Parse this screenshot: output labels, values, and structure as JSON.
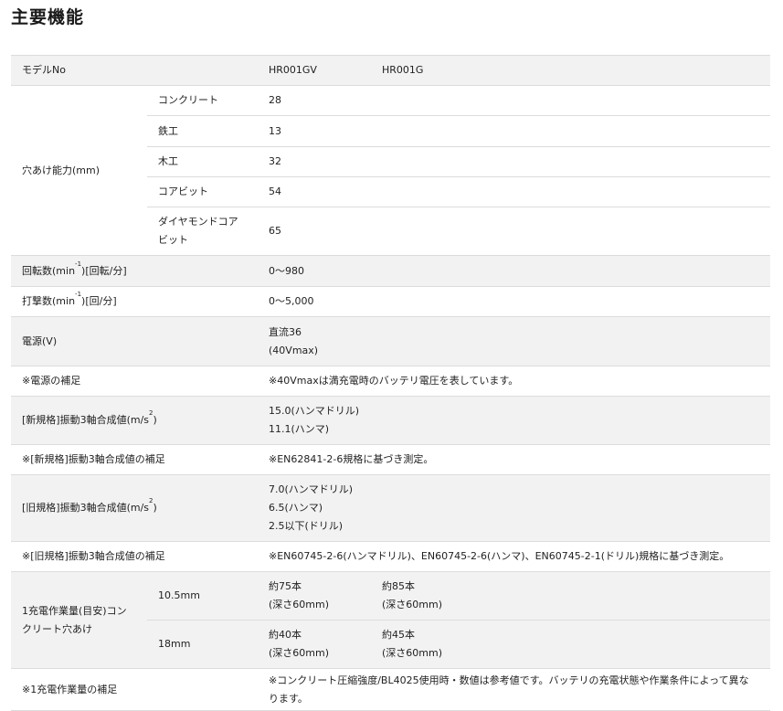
{
  "title": "主要機能",
  "header": {
    "label": "モデルNo",
    "col1": "HR001GV",
    "col2": "HR001G"
  },
  "drilling": {
    "label": "穴あけ能力(mm)",
    "items": [
      {
        "label": "コンクリート",
        "value": "28"
      },
      {
        "label": "鉄工",
        "value": "13"
      },
      {
        "label": "木工",
        "value": "32"
      },
      {
        "label": "コアビット",
        "value": "54"
      },
      {
        "label_lines": [
          "ダイヤモンドコア",
          "ビット"
        ],
        "value": "65"
      }
    ]
  },
  "rotation": {
    "label_pre": "回転数(min",
    "label_sup": "-1",
    "label_post": ")[回転/分]",
    "value": "0〜980"
  },
  "impact": {
    "label_pre": "打撃数(min",
    "label_sup": "-1",
    "label_post": ")[回/分]",
    "value": "0〜5,000"
  },
  "power": {
    "label": "電源(V)",
    "lines": [
      "直流36",
      "(40Vmax)"
    ]
  },
  "power_note": {
    "label": "※電源の補足",
    "value": "※40Vmaxは満充電時のバッテリ電圧を表しています。"
  },
  "vib_new": {
    "label_pre": "[新規格]振動3軸合成値(m/s",
    "label_sup": "2",
    "label_post": ")",
    "lines": [
      "15.0(ハンマドリル)",
      "11.1(ハンマ)"
    ]
  },
  "vib_new_note": {
    "label": "※[新規格]振動3軸合成値の補足",
    "value": "※EN62841-2-6規格に基づき測定。"
  },
  "vib_old": {
    "label_pre": "[旧規格]振動3軸合成値(m/s",
    "label_sup": "2",
    "label_post": ")",
    "lines": [
      "7.0(ハンマドリル)",
      "6.5(ハンマ)",
      "2.5以下(ドリル)"
    ]
  },
  "vib_old_note": {
    "label": "※[旧規格]振動3軸合成値の補足",
    "value": "※EN60745-2-6(ハンマドリル)、EN60745-2-6(ハンマ)、EN60745-2-1(ドリル)規格に基づき測定。"
  },
  "work": {
    "label_lines": [
      "1充電作業量(目安)コン",
      "クリート穴あけ"
    ],
    "rows": [
      {
        "size": "10.5mm",
        "v1": [
          "約75本",
          "(深さ60mm)"
        ],
        "v2": [
          "約85本",
          "(深さ60mm)"
        ]
      },
      {
        "size": "18mm",
        "v1": [
          "約40本",
          "(深さ60mm)"
        ],
        "v2": [
          "約45本",
          "(深さ60mm)"
        ]
      }
    ]
  },
  "work_note": {
    "label": "※1充電作業量の補足",
    "lines": [
      "※コンクリート圧縮強度/BL4025使用時・数値は参考値です。バッテリの充電状態や作業条件によって異な",
      "ります。"
    ]
  }
}
